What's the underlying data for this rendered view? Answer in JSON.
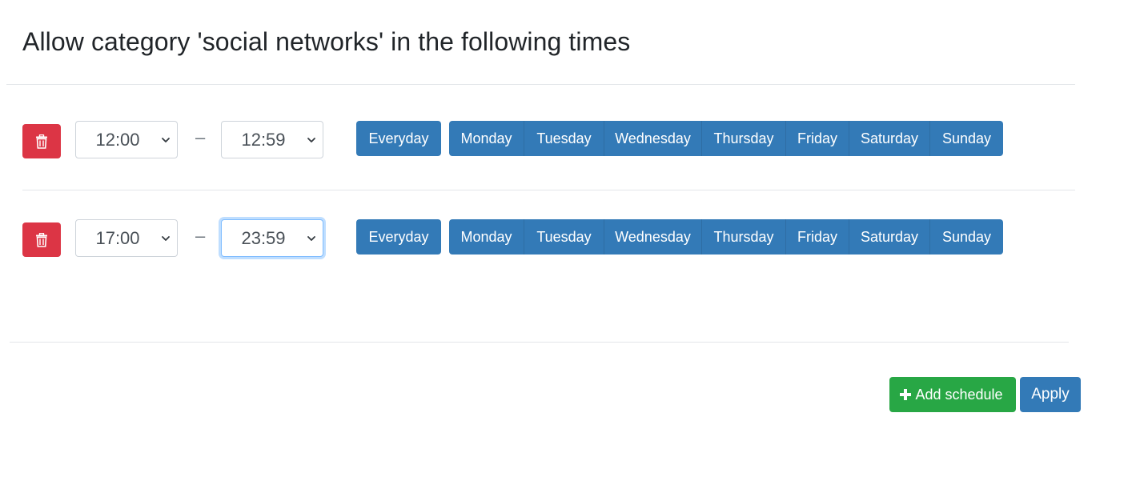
{
  "header": {
    "title": "Allow category 'social networks' in the following times"
  },
  "schedules": [
    {
      "start_time": "12:00",
      "end_time": "12:59",
      "separator": "–",
      "everyday_label": "Everyday",
      "days": [
        "Monday",
        "Tuesday",
        "Wednesday",
        "Thursday",
        "Friday",
        "Saturday",
        "Sunday"
      ]
    },
    {
      "start_time": "17:00",
      "end_time": "23:59",
      "separator": "–",
      "everyday_label": "Everyday",
      "days": [
        "Monday",
        "Tuesday",
        "Wednesday",
        "Thursday",
        "Friday",
        "Saturday",
        "Sunday"
      ]
    }
  ],
  "footer": {
    "add_label": "Add schedule",
    "apply_label": "Apply"
  },
  "colors": {
    "delete": "#dc3545",
    "day_button": "#337ab7",
    "add_button": "#28a745",
    "apply_button": "#337ab7"
  },
  "icons": {
    "delete": "trash-icon",
    "select": "chevron-down-icon",
    "add": "plus-icon"
  }
}
